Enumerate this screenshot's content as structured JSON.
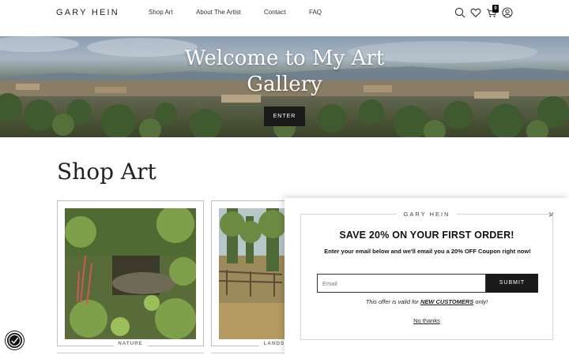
{
  "header": {
    "logo": "GARY HEIN",
    "nav": [
      "Shop Art",
      "About The Artist",
      "Contact",
      "FAQ"
    ],
    "icons": [
      "search-icon",
      "heart-icon",
      "cart-icon",
      "account-icon"
    ],
    "cart_count": "0"
  },
  "hero": {
    "title": "Welcome to My Art Gallery",
    "button": "ENTER"
  },
  "shop": {
    "title": "Shop Art",
    "cards": [
      {
        "label": "NATURE"
      },
      {
        "label": "LANDSCAPES"
      }
    ]
  },
  "popup": {
    "brand": "GARY HEIN",
    "close": "×",
    "headline": "SAVE 20% ON YOUR FIRST ORDER!",
    "subtext": "Enter your email below and we'll email you a 20% OFF Coupon right now!",
    "email_placeholder": "Email",
    "submit": "SUBMIT",
    "offer_prefix": "This offer is valid for",
    "offer_highlight": "NEW CUSTOMERS",
    "offer_suffix": "only!",
    "no_thanks": "No thanks"
  },
  "accessibility": {
    "icon": "accessibility-icon"
  },
  "colors": {
    "accent": "#1a1a1a",
    "text": "#222222",
    "border": "#bfbfbf"
  }
}
